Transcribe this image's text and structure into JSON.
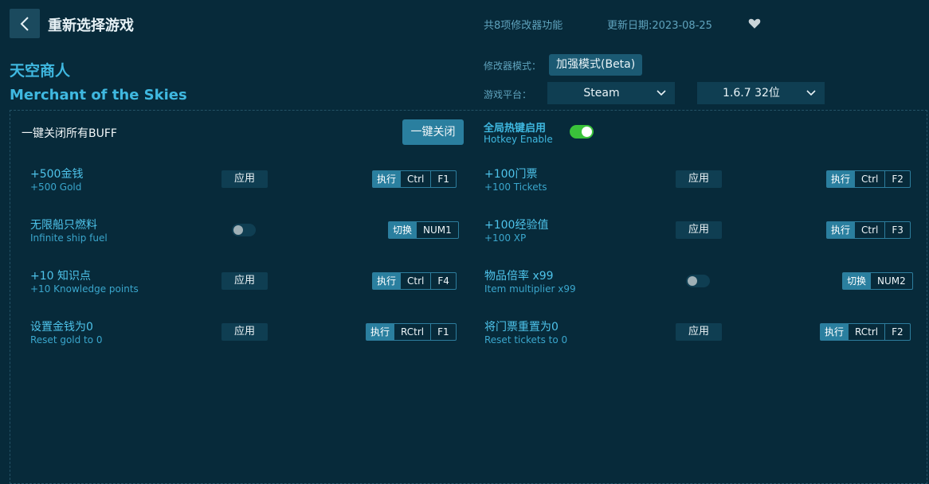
{
  "header": {
    "title": "重新选择游戏",
    "feature_count": "共8项修改器功能",
    "update_date": "更新日期:2023-08-25"
  },
  "game": {
    "name_cn": "天空商人",
    "name_en": "Merchant of the Skies"
  },
  "meta": {
    "mode_label": "修改器模式：",
    "mode_value": "加强模式(Beta)",
    "platform_label": "游戏平台：",
    "platform_value": "Steam",
    "version_value": "1.6.7 32位"
  },
  "global": {
    "close_all_label": "一键关闭所有BUFF",
    "close_all_button": "一键关闭",
    "hotkey_cn": "全局热键启用",
    "hotkey_en": "Hotkey Enable",
    "hotkey_enabled": true
  },
  "labels": {
    "apply": "应用",
    "execute": "执行",
    "switch": "切换"
  },
  "options": [
    {
      "cn": "+500金钱",
      "en": "+500 Gold",
      "control": "apply",
      "keys": [
        "Ctrl",
        "F1"
      ]
    },
    {
      "cn": "+100门票",
      "en": "+100 Tickets",
      "control": "apply",
      "keys": [
        "Ctrl",
        "F2"
      ]
    },
    {
      "cn": "无限船只燃料",
      "en": "Infinite ship fuel",
      "control": "toggle",
      "keys": [
        "NUM1"
      ]
    },
    {
      "cn": "+100经验值",
      "en": "+100 XP",
      "control": "apply",
      "keys": [
        "Ctrl",
        "F3"
      ]
    },
    {
      "cn": "+10 知识点",
      "en": "+10 Knowledge points",
      "control": "apply",
      "keys": [
        "Ctrl",
        "F4"
      ]
    },
    {
      "cn": "物品倍率 x99",
      "en": "Item multiplier x99",
      "control": "toggle",
      "keys": [
        "NUM2"
      ]
    },
    {
      "cn": "设置金钱为0",
      "en": "Reset gold to 0",
      "control": "apply",
      "keys": [
        "RCtrl",
        "F1"
      ]
    },
    {
      "cn": "将门票重置为0",
      "en": "Reset tickets to 0",
      "control": "apply",
      "keys": [
        "RCtrl",
        "F2"
      ]
    }
  ],
  "colors": {
    "background": "#072a3a",
    "accent": "#3fb8e0",
    "button": "#2a7f9f",
    "toggle_on": "#3ac23a"
  },
  "icons": [
    "chevron-left-icon",
    "heart-icon",
    "chevron-down-icon"
  ]
}
